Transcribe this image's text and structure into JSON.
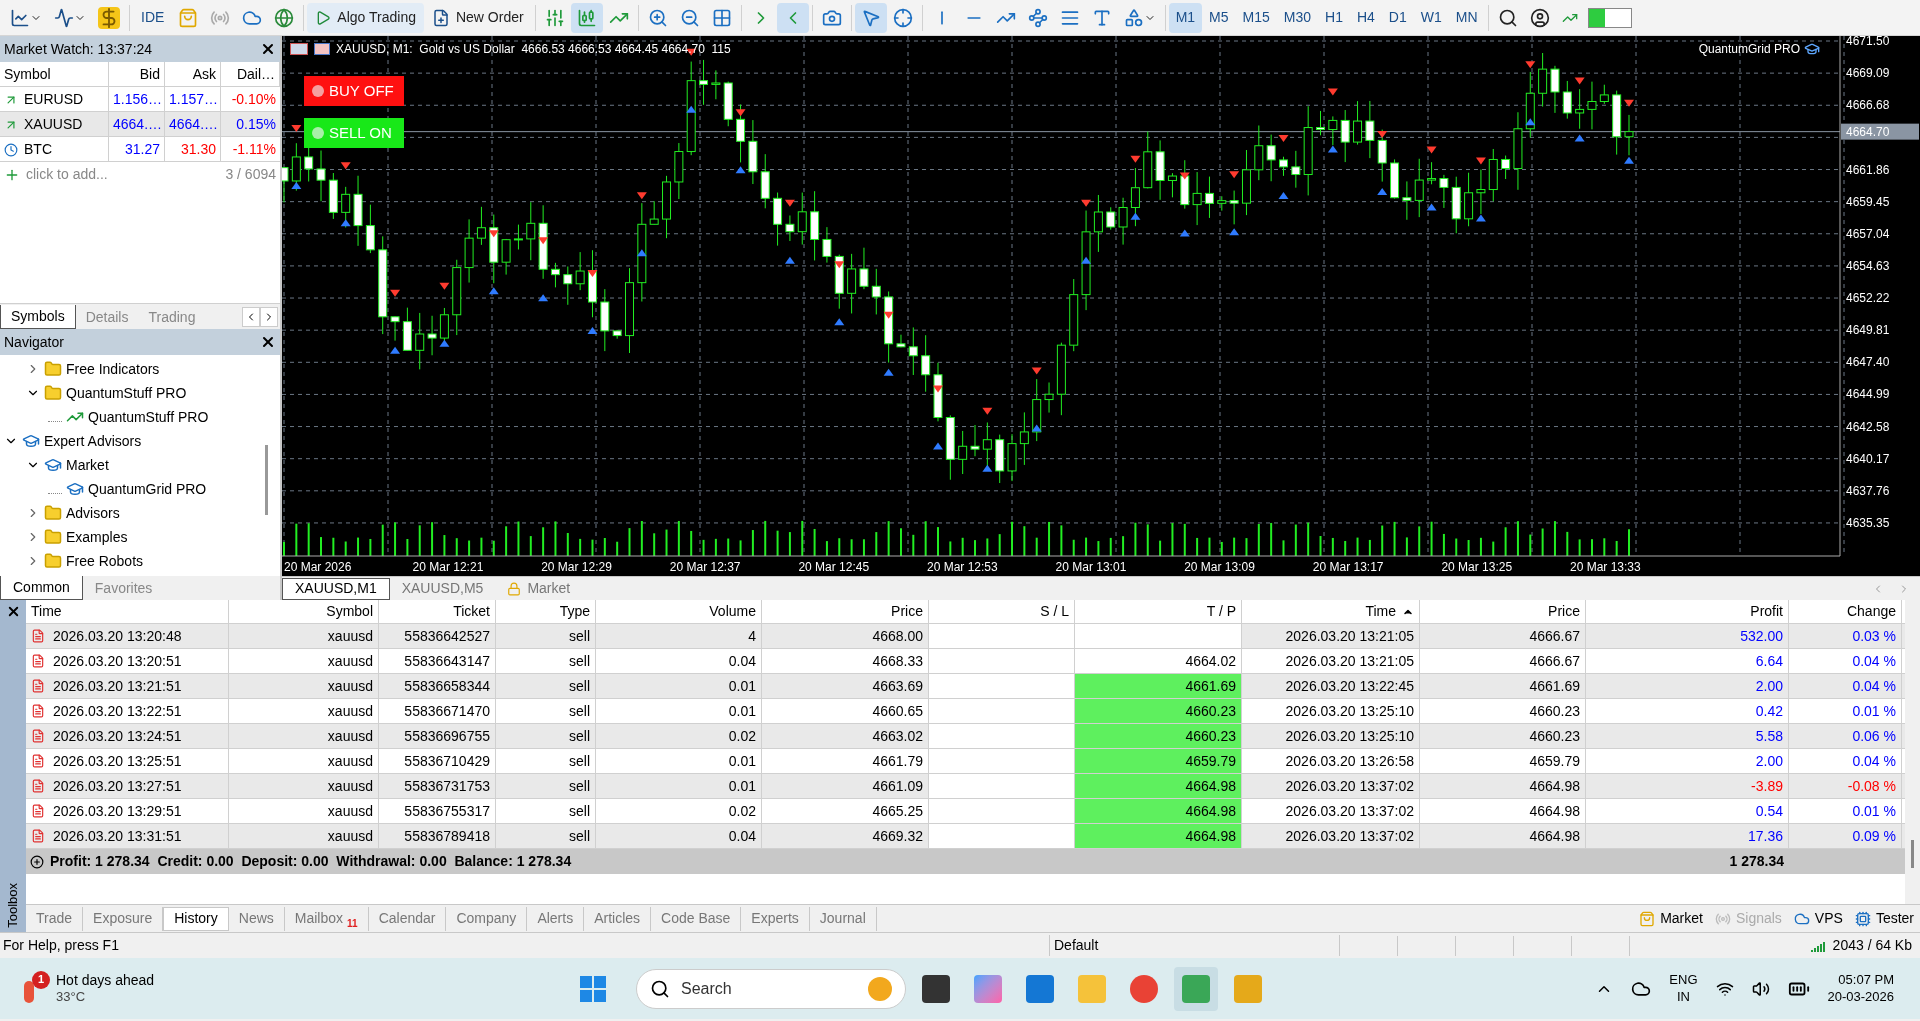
{
  "toolbar": {
    "ide": "IDE",
    "algo_trading": "Algo Trading",
    "new_order": "New Order",
    "timeframes": [
      {
        "label": "M1",
        "selected": true
      },
      {
        "label": "M5",
        "selected": false
      },
      {
        "label": "M15",
        "selected": false
      },
      {
        "label": "M30",
        "selected": false
      },
      {
        "label": "H1",
        "selected": false
      },
      {
        "label": "H4",
        "selected": false
      },
      {
        "label": "D1",
        "selected": false
      },
      {
        "label": "W1",
        "selected": false
      },
      {
        "label": "MN",
        "selected": false
      }
    ]
  },
  "market_watch": {
    "title": "Market Watch: 13:37:24",
    "columns": [
      "Symbol",
      "Bid",
      "Ask",
      "Dail…"
    ],
    "rows": [
      {
        "kind": "arrow",
        "symbol": "EURUSD",
        "bid": "1.156…",
        "ask": "1.157…",
        "daily": "-0.10%",
        "bid_down": false,
        "ask_down": false,
        "daily_down": true,
        "selected": false
      },
      {
        "kind": "arrow",
        "symbol": "XAUUSD",
        "bid": "4664.…",
        "ask": "4664.…",
        "daily": "0.15%",
        "bid_down": false,
        "ask_down": false,
        "daily_down": false,
        "selected": true
      },
      {
        "kind": "clock",
        "symbol": "BTC",
        "bid": "31.27",
        "ask": "31.30",
        "daily": "-1.11%",
        "bid_down": false,
        "ask_down": true,
        "daily_down": true,
        "selected": false
      }
    ],
    "add_hint": "click to add...",
    "count": "3 / 6094",
    "tabs": [
      {
        "label": "Symbols",
        "selected": true
      },
      {
        "label": "Details",
        "selected": false
      },
      {
        "label": "Trading",
        "selected": false
      }
    ]
  },
  "navigator": {
    "title": "Navigator",
    "items": [
      {
        "kind": "group",
        "children": [
          {
            "kind": "folder",
            "label": "Free Indicators",
            "expanded": false
          },
          {
            "kind": "folder",
            "label": "QuantumStuff PRO",
            "expanded": true,
            "children": [
              {
                "kind": "indicator",
                "label": "QuantumStuff PRO"
              }
            ]
          }
        ]
      },
      {
        "kind": "cap",
        "label": "Expert Advisors",
        "expanded": true,
        "children": [
          {
            "kind": "cap",
            "label": "Market",
            "expanded": true,
            "children": [
              {
                "kind": "cap",
                "label": "QuantumGrid PRO"
              }
            ]
          },
          {
            "kind": "folder",
            "label": "Advisors",
            "expanded": false
          },
          {
            "kind": "folder",
            "label": "Examples",
            "expanded": false
          },
          {
            "kind": "folder",
            "label": "Free Robots",
            "expanded": false
          }
        ]
      }
    ],
    "tabs": [
      {
        "label": "Common",
        "selected": true
      },
      {
        "label": "Favorites",
        "selected": false
      }
    ]
  },
  "chart": {
    "title": "XAUUSD, M1:  Gold vs US Dollar  4666.53 4666.53 4664.45 4664.70  115",
    "expert": "QuantumGrid PRO",
    "buttons": [
      {
        "label": "BUY OFF",
        "on": false
      },
      {
        "label": "SELL ON",
        "on": true
      }
    ],
    "price_ticks": [
      "4671.50",
      "4669.09",
      "4666.68",
      "4661.86",
      "4659.45",
      "4657.04",
      "4654.63",
      "4652.22",
      "4649.81",
      "4647.40",
      "4644.99",
      "4642.58",
      "4640.17",
      "4637.76",
      "4635.35"
    ],
    "current_price": "4664.70",
    "time_ticks": [
      "20 Mar 2026",
      "20 Mar 12:21",
      "20 Mar 12:29",
      "20 Mar 12:37",
      "20 Mar 12:45",
      "20 Mar 12:53",
      "20 Mar 13:01",
      "20 Mar 13:09",
      "20 Mar 13:17",
      "20 Mar 13:25",
      "20 Mar 13:33"
    ]
  },
  "chart_tabs": [
    {
      "kind": "chart",
      "label": "XAUUSD,M1",
      "selected": true
    },
    {
      "kind": "chart",
      "label": "XAUUSD,M5",
      "selected": false
    },
    {
      "kind": "market",
      "label": "Market",
      "selected": false
    }
  ],
  "toolbox": {
    "label": "Toolbox",
    "columns": [
      {
        "label": "Time",
        "sorted": false
      },
      {
        "label": "Symbol",
        "sorted": false
      },
      {
        "label": "Ticket",
        "sorted": false
      },
      {
        "label": "Type",
        "sorted": false
      },
      {
        "label": "Volume",
        "sorted": false
      },
      {
        "label": "Price",
        "sorted": false
      },
      {
        "label": "S / L",
        "sorted": false
      },
      {
        "label": "T / P",
        "sorted": false
      },
      {
        "label": "Time",
        "sorted": true
      },
      {
        "label": "Price",
        "sorted": false
      },
      {
        "label": "Profit",
        "sorted": false
      },
      {
        "label": "Change",
        "sorted": false
      }
    ],
    "rows": [
      {
        "time": "2026.03.20 13:20:48",
        "symbol": "xauusd",
        "ticket": "55836642527",
        "type": "sell",
        "volume": "4",
        "price": "4668.00",
        "tp_hit": false,
        "close_time": "2026.03.20 13:21:05",
        "close_price": "4666.67",
        "profit": "532.00",
        "change": "0.03 %",
        "loss": false
      },
      {
        "time": "2026.03.20 13:20:51",
        "symbol": "xauusd",
        "ticket": "55836643147",
        "type": "sell",
        "volume": "0.04",
        "price": "4668.33",
        "tp": "4664.02",
        "tp_hit": false,
        "close_time": "2026.03.20 13:21:05",
        "close_price": "4666.67",
        "profit": "6.64",
        "change": "0.04 %",
        "loss": false
      },
      {
        "time": "2026.03.20 13:21:51",
        "symbol": "xauusd",
        "ticket": "55836658344",
        "type": "sell",
        "volume": "0.01",
        "price": "4663.69",
        "tp": "4661.69",
        "tp_hit": true,
        "close_time": "2026.03.20 13:22:45",
        "close_price": "4661.69",
        "profit": "2.00",
        "change": "0.04 %",
        "loss": false
      },
      {
        "time": "2026.03.20 13:22:51",
        "symbol": "xauusd",
        "ticket": "55836671470",
        "type": "sell",
        "volume": "0.01",
        "price": "4660.65",
        "tp": "4660.23",
        "tp_hit": true,
        "close_time": "2026.03.20 13:25:10",
        "close_price": "4660.23",
        "profit": "0.42",
        "change": "0.01 %",
        "loss": false
      },
      {
        "time": "2026.03.20 13:24:51",
        "symbol": "xauusd",
        "ticket": "55836696755",
        "type": "sell",
        "volume": "0.02",
        "price": "4663.02",
        "tp": "4660.23",
        "tp_hit": true,
        "close_time": "2026.03.20 13:25:10",
        "close_price": "4660.23",
        "profit": "5.58",
        "change": "0.06 %",
        "loss": false
      },
      {
        "time": "2026.03.20 13:25:51",
        "symbol": "xauusd",
        "ticket": "55836710429",
        "type": "sell",
        "volume": "0.01",
        "price": "4661.79",
        "tp": "4659.79",
        "tp_hit": true,
        "close_time": "2026.03.20 13:26:58",
        "close_price": "4659.79",
        "profit": "2.00",
        "change": "0.04 %",
        "loss": false
      },
      {
        "time": "2026.03.20 13:27:51",
        "symbol": "xauusd",
        "ticket": "55836731753",
        "type": "sell",
        "volume": "0.01",
        "price": "4661.09",
        "tp": "4664.98",
        "tp_hit": true,
        "close_time": "2026.03.20 13:37:02",
        "close_price": "4664.98",
        "profit": "-3.89",
        "change": "-0.08 %",
        "loss": true
      },
      {
        "time": "2026.03.20 13:29:51",
        "symbol": "xauusd",
        "ticket": "55836755317",
        "type": "sell",
        "volume": "0.02",
        "price": "4665.25",
        "tp": "4664.98",
        "tp_hit": true,
        "close_time": "2026.03.20 13:37:02",
        "close_price": "4664.98",
        "profit": "0.54",
        "change": "0.01 %",
        "loss": false
      },
      {
        "time": "2026.03.20 13:31:51",
        "symbol": "xauusd",
        "ticket": "55836789418",
        "type": "sell",
        "volume": "0.04",
        "price": "4669.32",
        "tp": "4664.98",
        "tp_hit": true,
        "close_time": "2026.03.20 13:37:02",
        "close_price": "4664.98",
        "profit": "17.36",
        "change": "0.09 %",
        "loss": false
      }
    ],
    "summary": "Profit: 1 278.34  Credit: 0.00  Deposit: 0.00  Withdrawal: 0.00  Balance: 1 278.34",
    "summary_total": "1 278.34",
    "tabs": [
      {
        "label": "Trade",
        "selected": false
      },
      {
        "label": "Exposure",
        "selected": false
      },
      {
        "label": "History",
        "selected": true
      },
      {
        "label": "News",
        "selected": false
      },
      {
        "label": "Mailbox",
        "badge": "11",
        "selected": false
      },
      {
        "label": "Calendar",
        "selected": false
      },
      {
        "label": "Company",
        "selected": false
      },
      {
        "label": "Alerts",
        "selected": false
      },
      {
        "label": "Articles",
        "selected": false
      },
      {
        "label": "Code Base",
        "selected": false
      },
      {
        "label": "Experts",
        "selected": false
      },
      {
        "label": "Journal",
        "selected": false
      }
    ],
    "tools": [
      {
        "kind": "market",
        "label": "Market",
        "disabled": false
      },
      {
        "kind": "signals",
        "label": "Signals",
        "disabled": true
      },
      {
        "kind": "vps",
        "label": "VPS",
        "disabled": false
      },
      {
        "kind": "tester",
        "label": "Tester",
        "disabled": false
      }
    ]
  },
  "status_bar": {
    "help": "For Help, press F1",
    "profile": "Default",
    "traffic": "2043 / 64 Kb"
  },
  "taskbar": {
    "weather_badge": "1",
    "weather_title": "Hot days ahead",
    "weather_temp": "33°C",
    "search_placeholder": "Search",
    "lang": "ENG",
    "region": "IN",
    "time": "05:07 PM",
    "date": "20-03-2026"
  }
}
